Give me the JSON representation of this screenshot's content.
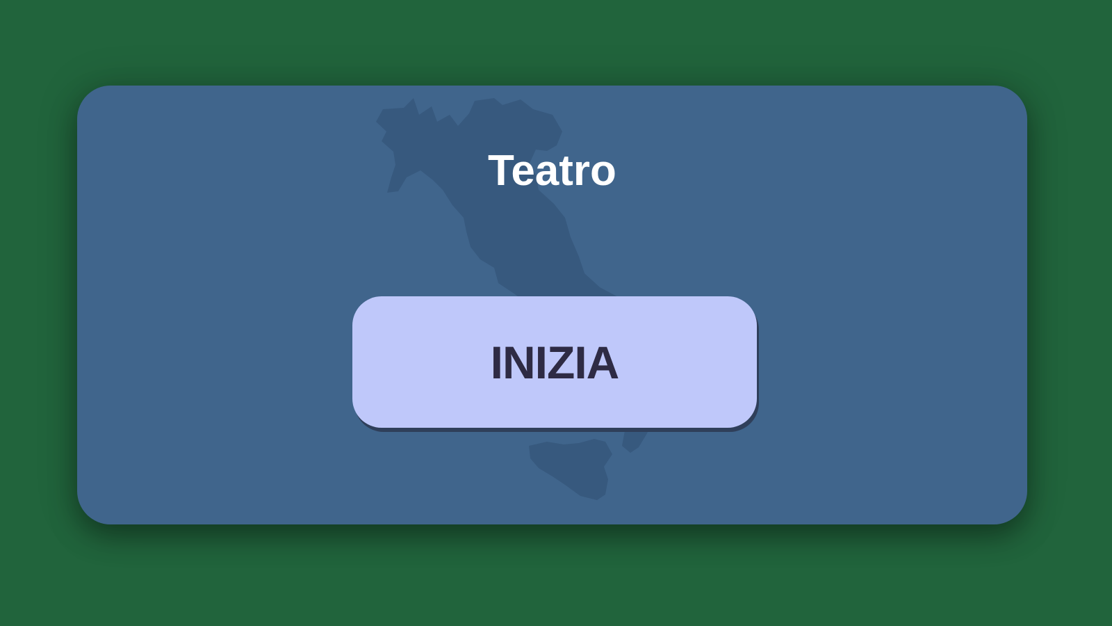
{
  "screen": {
    "title": "Teatro",
    "start_label": "INIZIA"
  },
  "background": {
    "icon": "italy-map-icon"
  },
  "colors": {
    "page_background": "#21643c",
    "card_background": "#40658c",
    "map_silhouette": "#37597e",
    "button_background": "#bfc8fa",
    "button_text": "#2e2b44",
    "title_text": "#ffffff"
  }
}
